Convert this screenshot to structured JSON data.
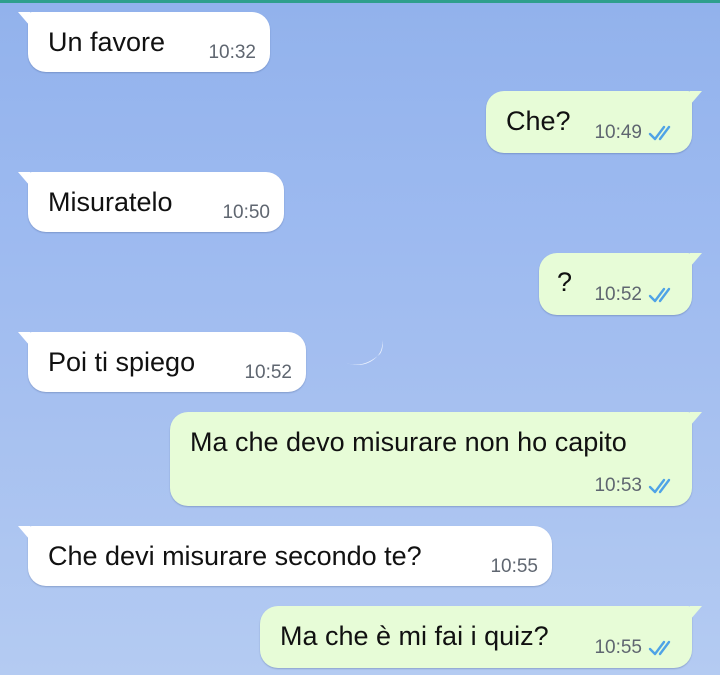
{
  "theme": {
    "incoming_bubble": "#ffffff",
    "outgoing_bubble": "#e7fcd7",
    "read_tick_color": "#4fa3e6",
    "time_color": "#5f6670"
  },
  "messages": [
    {
      "direction": "incoming",
      "text": "Un favore",
      "time": "10:32"
    },
    {
      "direction": "outgoing",
      "text": "Che?",
      "time": "10:49",
      "status": "read-ticks-icon"
    },
    {
      "direction": "incoming",
      "text": "Misuratelo",
      "time": "10:50"
    },
    {
      "direction": "outgoing",
      "text": "?",
      "time": "10:52",
      "status": "read-ticks-icon"
    },
    {
      "direction": "incoming",
      "text": "Poi ti spiego",
      "time": "10:52"
    },
    {
      "direction": "outgoing",
      "text": "Ma che devo misurare non ho capito",
      "time": "10:53",
      "status": "read-ticks-icon"
    },
    {
      "direction": "incoming",
      "text": "Che devi misurare secondo te?",
      "time": "10:55"
    },
    {
      "direction": "outgoing",
      "text": "Ma che è mi fai i quiz?",
      "time": "10:55",
      "status": "read-ticks-icon"
    }
  ]
}
